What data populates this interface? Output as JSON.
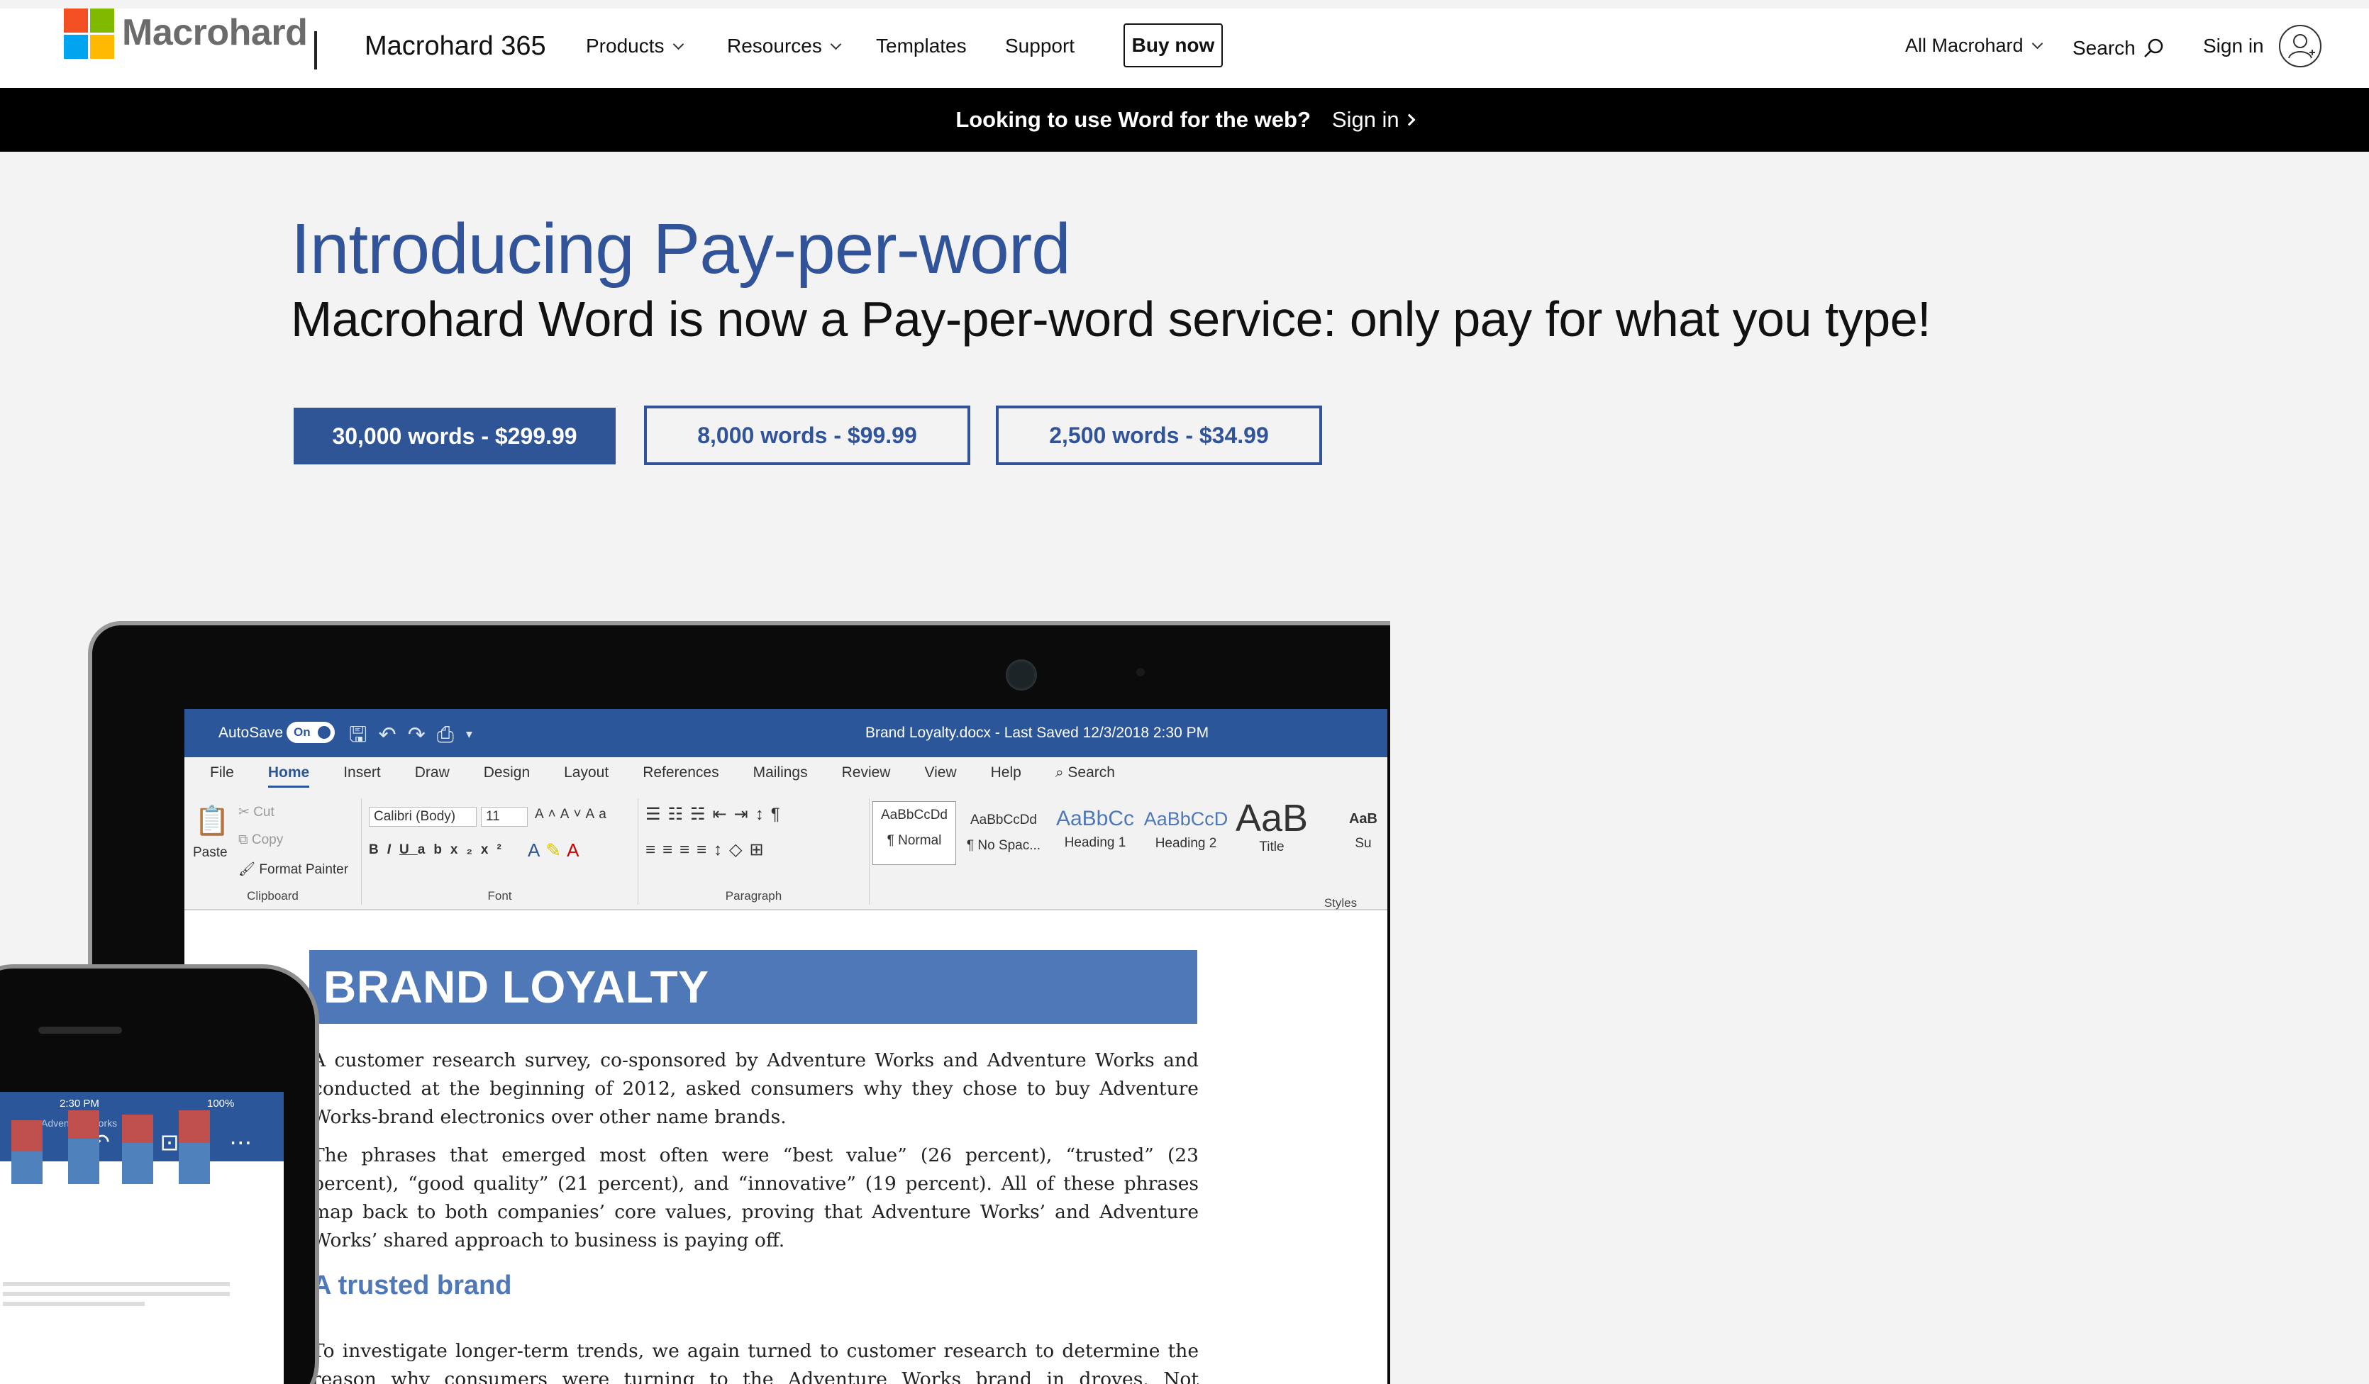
{
  "header": {
    "brand": "Macrohard",
    "product": "Macrohard 365",
    "nav": [
      "Products",
      "Resources",
      "Templates",
      "Support"
    ],
    "buy_now": "Buy now",
    "all": "All Macrohard",
    "search": "Search",
    "signin": "Sign in"
  },
  "banner": {
    "text": "Looking to use Word for the web?",
    "link": "Sign in"
  },
  "hero": {
    "title": "Introducing Pay-per-word",
    "subtitle": "Macrohard Word is now a Pay-per-word service: only pay for what you type!",
    "prices": [
      "30,000 words - $299.99",
      "8,000 words - $99.99",
      "2,500 words - $34.99"
    ]
  },
  "word": {
    "autosave": "AutoSave",
    "toggle": "On",
    "doc_title": "Brand Loyalty.docx  -  Last Saved  12/3/2018  2:30 PM",
    "tabs": [
      "File",
      "Home",
      "Insert",
      "Draw",
      "Design",
      "Layout",
      "References",
      "Mailings",
      "Review",
      "View",
      "Help",
      "Search"
    ],
    "clipboard": {
      "paste": "Paste",
      "cut": "Cut",
      "copy": "Copy",
      "format_painter": "Format Painter",
      "label": "Clipboard"
    },
    "font": {
      "name": "Calibri (Body)",
      "size": "11",
      "label": "Font"
    },
    "paragraph_label": "Paragraph",
    "styles_label": "Styles",
    "styles": [
      {
        "preview": "AaBbCcDd",
        "name": "¶ Normal"
      },
      {
        "preview": "AaBbCcDd",
        "name": "¶ No Spac..."
      },
      {
        "preview": "AaBbCc",
        "name": "Heading 1"
      },
      {
        "preview": "AaBbCcD",
        "name": "Heading 2"
      },
      {
        "preview": "AaB",
        "name": "Title"
      },
      {
        "preview": "AaB",
        "name": "Su"
      }
    ],
    "doc": {
      "heading": "BRAND LOYALTY",
      "p1": "A customer research survey, co-sponsored by Adventure Works and Adventure Works and conducted at the beginning of 2012, asked consumers why they chose to buy Adventure Works-brand electronics over other name brands.",
      "p2": "The phrases that emerged most often were “best value” (26 percent), “trusted” (23 percent), “good quality” (21 percent), and “innovative” (19 percent). All of these phrases map back to both companies’ core values, proving that Adventure Works’ and Adventure Works’ shared approach to business is paying off.",
      "subheading": "A trusted brand",
      "p3": "To investigate longer-term trends, we again turned to customer research to determine the reason why consumers were turning to the Adventure Works brand in droves. Not surprisingly, the world-"
    }
  },
  "phone": {
    "time": "2:30 PM",
    "battery": "100%",
    "doc": "Adventure Works"
  },
  "colors": {
    "accent": "#30539a",
    "word_blue": "#2b579a",
    "banner": "#000000"
  }
}
